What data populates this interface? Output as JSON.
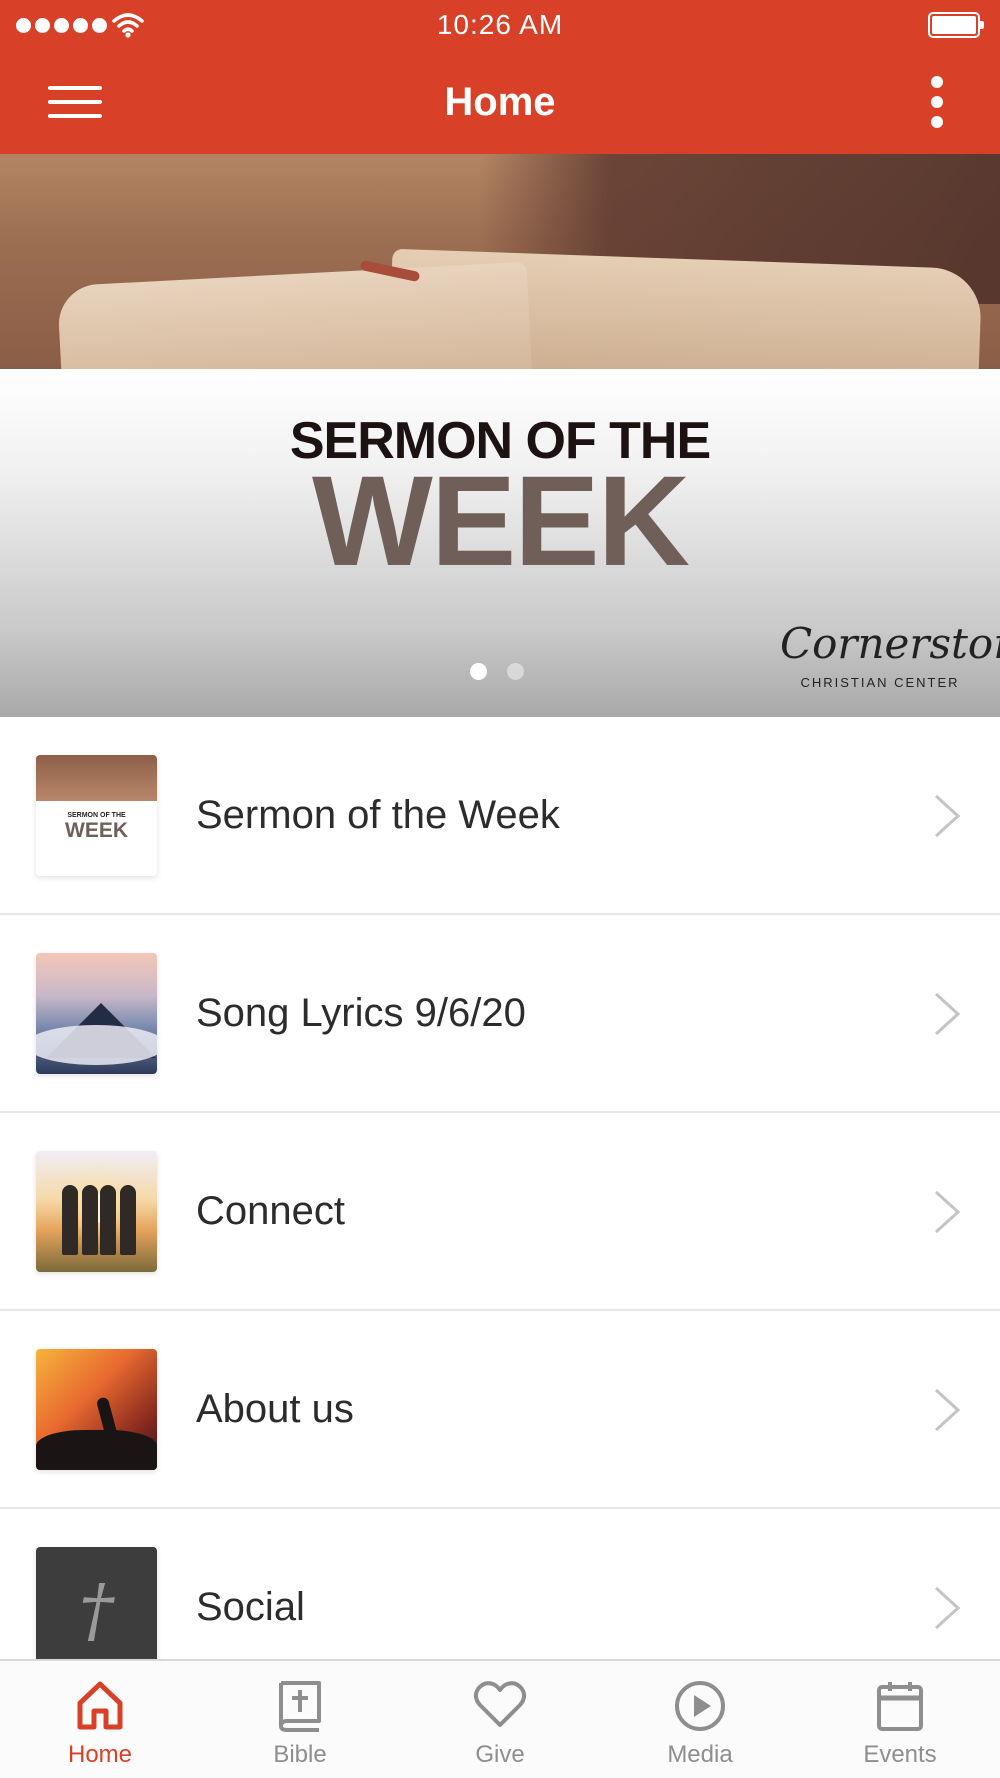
{
  "status_bar": {
    "time": "10:26 AM",
    "signal_icon": "signal-dots-icon",
    "wifi_icon": "wifi-icon",
    "battery_icon": "battery-full-icon"
  },
  "nav": {
    "title": "Home",
    "menu_icon": "hamburger-menu-icon",
    "more_icon": "more-vertical-icon"
  },
  "hero": {
    "kicker": "SERMON OF THE",
    "title": "WEEK",
    "brand_script": "Cornerstone",
    "brand_sub": "CHRISTIAN CENTER",
    "pages": 2,
    "active_page": 1
  },
  "list": {
    "items": [
      {
        "label": "Sermon of the Week",
        "thumb": "sermon-week-thumbnail",
        "thumb_kicker": "SERMON OF THE",
        "thumb_title": "WEEK"
      },
      {
        "label": "Song Lyrics 9/6/20",
        "thumb": "mountain-clouds-thumbnail"
      },
      {
        "label": "Connect",
        "thumb": "friends-sunset-thumbnail"
      },
      {
        "label": "About us",
        "thumb": "worship-crowd-thumbnail"
      },
      {
        "label": "Social",
        "thumb": "cross-thumbnail"
      }
    ]
  },
  "tabs": [
    {
      "label": "Home",
      "icon": "home-icon",
      "active": true
    },
    {
      "label": "Bible",
      "icon": "bible-icon",
      "active": false
    },
    {
      "label": "Give",
      "icon": "heart-icon",
      "active": false
    },
    {
      "label": "Media",
      "icon": "play-circle-icon",
      "active": false
    },
    {
      "label": "Events",
      "icon": "calendar-icon",
      "active": false
    }
  ],
  "colors": {
    "brand": "#d84128",
    "tab_inactive": "#8e8e8e",
    "list_text": "#2c2c2c",
    "divider": "#e6e6e6"
  }
}
